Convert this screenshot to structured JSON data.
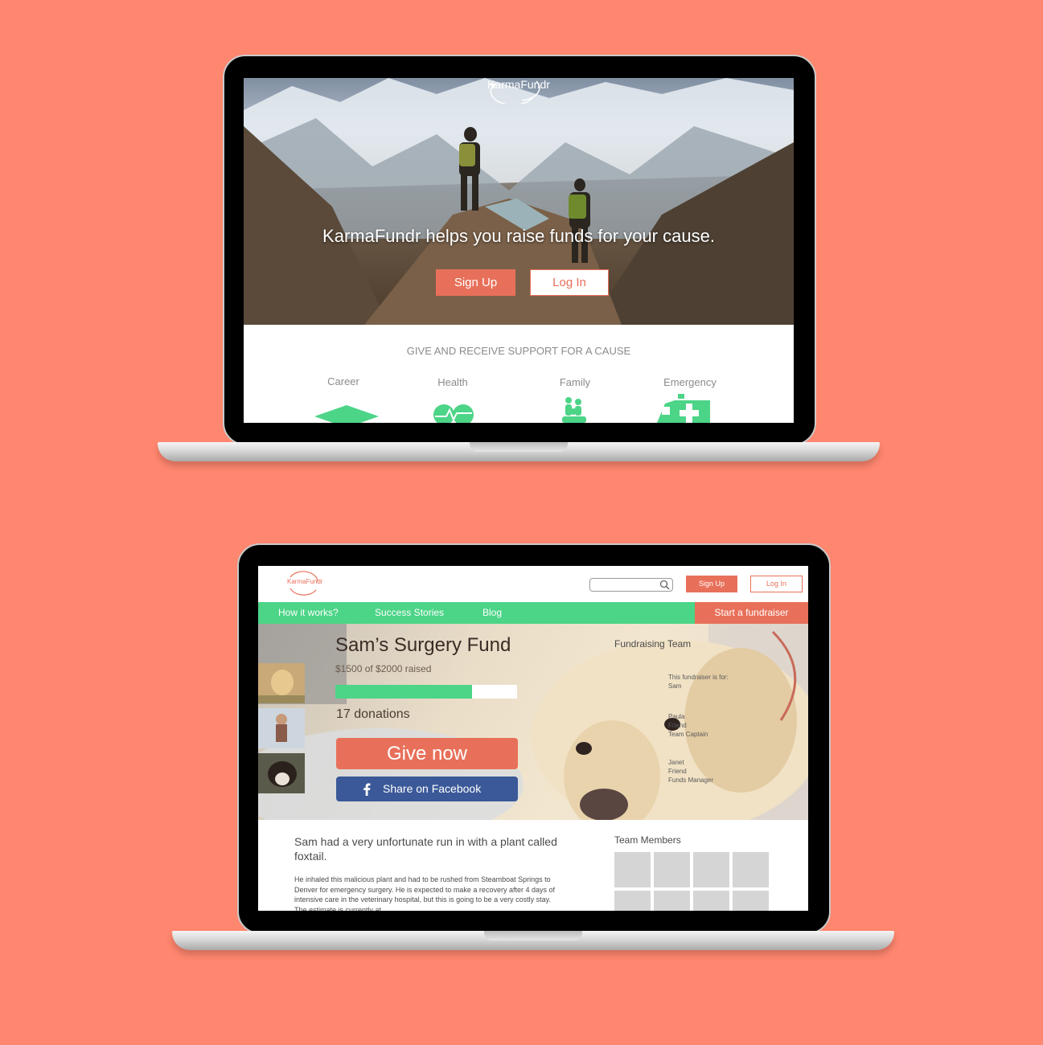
{
  "landing": {
    "logo_text": "KarmaFundr",
    "tagline": "KarmaFundr helps you raise funds for your cause.",
    "signup_label": "Sign Up",
    "login_label": "Log In",
    "section_title": "GIVE AND RECEIVE SUPPORT FOR A CAUSE",
    "causes": [
      {
        "label": "Career",
        "icon": "graduation-cap-icon"
      },
      {
        "label": "Health",
        "icon": "heart-icon"
      },
      {
        "label": "Family",
        "icon": "family-icon"
      },
      {
        "label": "Emergency",
        "icon": "ambulance-icon"
      }
    ]
  },
  "fund_page": {
    "logo_text": "KarmaFundr",
    "search": {
      "placeholder": "",
      "value": ""
    },
    "signup_label": "Sign Up",
    "login_label": "Log In",
    "nav": {
      "items": [
        "How it works?",
        "Success Stories",
        "Blog"
      ],
      "start_label": "Start a fundraiser"
    },
    "title": "Sam’s Surgery Fund",
    "raised_text": "$1500 of $2000 raised",
    "progress": 0.75,
    "donations_text": "17 donations",
    "give_label": "Give now",
    "share_label": "Share on Facebook",
    "team_title": "Fundraising Team",
    "team": [
      {
        "lines": [
          "This fundraiser is for:",
          "Sam"
        ]
      },
      {
        "lines": [
          "Paula",
          "Friend",
          "Team Captain"
        ]
      },
      {
        "lines": [
          "Janet",
          "Friend",
          "Funds Manager"
        ]
      }
    ],
    "lead_text": "Sam had a very unfortunate run in with a plant called foxtail.",
    "body_text": "He inhaled this malicious plant and had to be rushed from Steamboat Springs to Denver for emergency surgery. He is expected to make a recovery after 4 days of intensive care in the veterinary hospital, but this is going to be a very costly stay. The estimate is currently at",
    "team_members_title": "Team Members"
  },
  "colors": {
    "background": "#ff866f",
    "accent": "#e8705a",
    "green": "#4cd487",
    "facebook": "#3b5998"
  }
}
